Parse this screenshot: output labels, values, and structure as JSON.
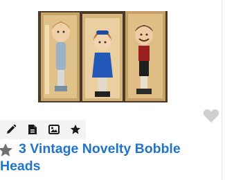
{
  "listing": {
    "title_line1": "3 Vintage Novelty Bobble",
    "title_line2": "Heads",
    "image_alt": "Three vintage bobble head figures in boxes"
  },
  "toolbar": {
    "items": [
      {
        "icon": "pencil-icon"
      },
      {
        "icon": "document-icon"
      },
      {
        "icon": "image-icon"
      },
      {
        "icon": "star-icon"
      }
    ]
  },
  "colors": {
    "title": "#1f73c9",
    "icon": "#1a1a1a",
    "heart": "#d0d0d0",
    "toolbar_bg": "#f4f4f4",
    "star_gray": "#707070"
  }
}
